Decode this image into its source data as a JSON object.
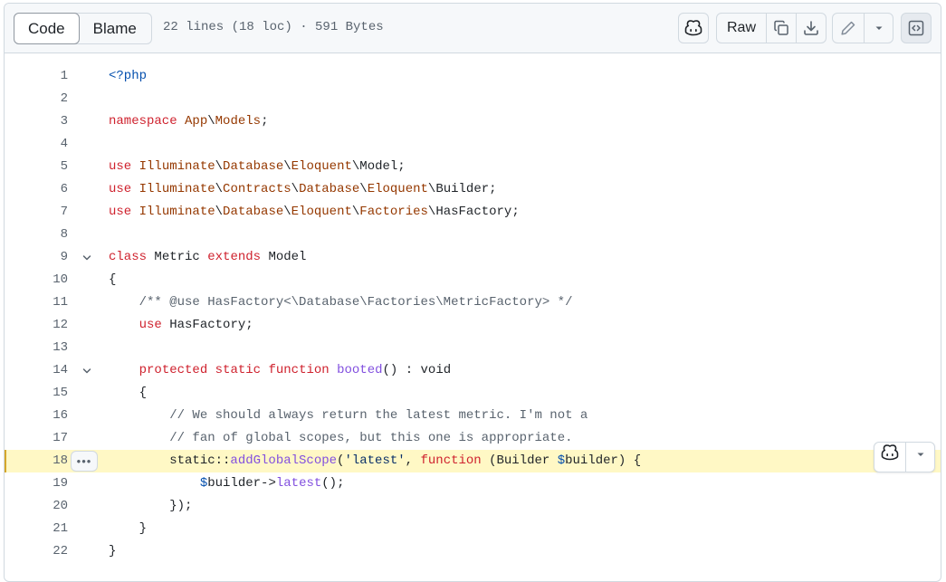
{
  "toolbar": {
    "tabs": [
      {
        "label": "Code",
        "active": true
      },
      {
        "label": "Blame",
        "active": false
      }
    ],
    "file_info": "22 lines (18 loc) · 591 Bytes",
    "raw_label": "Raw",
    "icons": {
      "copilot": "copilot-icon",
      "copy": "copy-icon",
      "download": "download-icon",
      "edit": "pencil-icon",
      "more": "triangle-down-icon",
      "symbols": "code-square-icon"
    }
  },
  "code": {
    "highlighted_line": 18,
    "colors": {
      "keyword": "#cf222e",
      "namespace": "#953800",
      "function": "#8250df",
      "variable": "#0550ae",
      "string": "#0a3069",
      "comment": "#59636e",
      "highlight_bg": "#fff8c5"
    },
    "lines": [
      {
        "n": "1",
        "tokens": [
          [
            "tag",
            "<?php"
          ]
        ]
      },
      {
        "n": "2",
        "tokens": []
      },
      {
        "n": "3",
        "tokens": [
          [
            "kw",
            "namespace"
          ],
          [
            "p",
            " "
          ],
          [
            "ns",
            "App"
          ],
          [
            "p",
            "\\"
          ],
          [
            "ns",
            "Models"
          ],
          [
            "p",
            ";"
          ]
        ]
      },
      {
        "n": "4",
        "tokens": []
      },
      {
        "n": "5",
        "tokens": [
          [
            "kw",
            "use"
          ],
          [
            "p",
            " "
          ],
          [
            "ns",
            "Illuminate"
          ],
          [
            "p",
            "\\"
          ],
          [
            "ns",
            "Database"
          ],
          [
            "p",
            "\\"
          ],
          [
            "ns",
            "Eloquent"
          ],
          [
            "p",
            "\\Model;"
          ]
        ]
      },
      {
        "n": "6",
        "tokens": [
          [
            "kw",
            "use"
          ],
          [
            "p",
            " "
          ],
          [
            "ns",
            "Illuminate"
          ],
          [
            "p",
            "\\"
          ],
          [
            "ns",
            "Contracts"
          ],
          [
            "p",
            "\\"
          ],
          [
            "ns",
            "Database"
          ],
          [
            "p",
            "\\"
          ],
          [
            "ns",
            "Eloquent"
          ],
          [
            "p",
            "\\Builder;"
          ]
        ]
      },
      {
        "n": "7",
        "tokens": [
          [
            "kw",
            "use"
          ],
          [
            "p",
            " "
          ],
          [
            "ns",
            "Illuminate"
          ],
          [
            "p",
            "\\"
          ],
          [
            "ns",
            "Database"
          ],
          [
            "p",
            "\\"
          ],
          [
            "ns",
            "Eloquent"
          ],
          [
            "p",
            "\\"
          ],
          [
            "ns",
            "Factories"
          ],
          [
            "p",
            "\\HasFactory;"
          ]
        ]
      },
      {
        "n": "8",
        "tokens": []
      },
      {
        "n": "9",
        "fold": true,
        "tokens": [
          [
            "kw",
            "class"
          ],
          [
            "p",
            " Metric "
          ],
          [
            "kw",
            "extends"
          ],
          [
            "p",
            " Model"
          ]
        ]
      },
      {
        "n": "10",
        "tokens": [
          [
            "p",
            "{"
          ]
        ]
      },
      {
        "n": "11",
        "tokens": [
          [
            "p",
            "    "
          ],
          [
            "cm",
            "/** @use HasFactory<\\Database\\Factories\\MetricFactory> */"
          ]
        ]
      },
      {
        "n": "12",
        "tokens": [
          [
            "p",
            "    "
          ],
          [
            "kw",
            "use"
          ],
          [
            "p",
            " HasFactory;"
          ]
        ]
      },
      {
        "n": "13",
        "tokens": []
      },
      {
        "n": "14",
        "fold": true,
        "tokens": [
          [
            "p",
            "    "
          ],
          [
            "kw",
            "protected"
          ],
          [
            "p",
            " "
          ],
          [
            "kw",
            "static"
          ],
          [
            "p",
            " "
          ],
          [
            "kw",
            "function"
          ],
          [
            "p",
            " "
          ],
          [
            "fn",
            "booted"
          ],
          [
            "p",
            "() : void"
          ]
        ]
      },
      {
        "n": "15",
        "tokens": [
          [
            "p",
            "    {"
          ]
        ]
      },
      {
        "n": "16",
        "tokens": [
          [
            "p",
            "        "
          ],
          [
            "cm",
            "// We should always return the latest metric. I'm not a"
          ]
        ]
      },
      {
        "n": "17",
        "tokens": [
          [
            "p",
            "        "
          ],
          [
            "cm",
            "// fan of global scopes, but this one is appropriate."
          ]
        ]
      },
      {
        "n": "18",
        "tokens": [
          [
            "p",
            "        static::"
          ],
          [
            "fn",
            "addGlobalScope"
          ],
          [
            "p",
            "("
          ],
          [
            "str",
            "'latest'"
          ],
          [
            "p",
            ", "
          ],
          [
            "kw",
            "function"
          ],
          [
            "p",
            " (Builder "
          ],
          [
            "var",
            "$"
          ],
          [
            "p",
            "builder) {"
          ]
        ]
      },
      {
        "n": "19",
        "tokens": [
          [
            "p",
            "            "
          ],
          [
            "var",
            "$"
          ],
          [
            "p",
            "builder->"
          ],
          [
            "fn",
            "latest"
          ],
          [
            "p",
            "();"
          ]
        ]
      },
      {
        "n": "20",
        "tokens": [
          [
            "p",
            "        });"
          ]
        ]
      },
      {
        "n": "21",
        "tokens": [
          [
            "p",
            "    }"
          ]
        ]
      },
      {
        "n": "22",
        "tokens": [
          [
            "p",
            "}"
          ]
        ]
      }
    ]
  },
  "line_menu": {
    "icons": [
      "copilot-icon",
      "triangle-down-icon"
    ],
    "dots": "•••"
  }
}
